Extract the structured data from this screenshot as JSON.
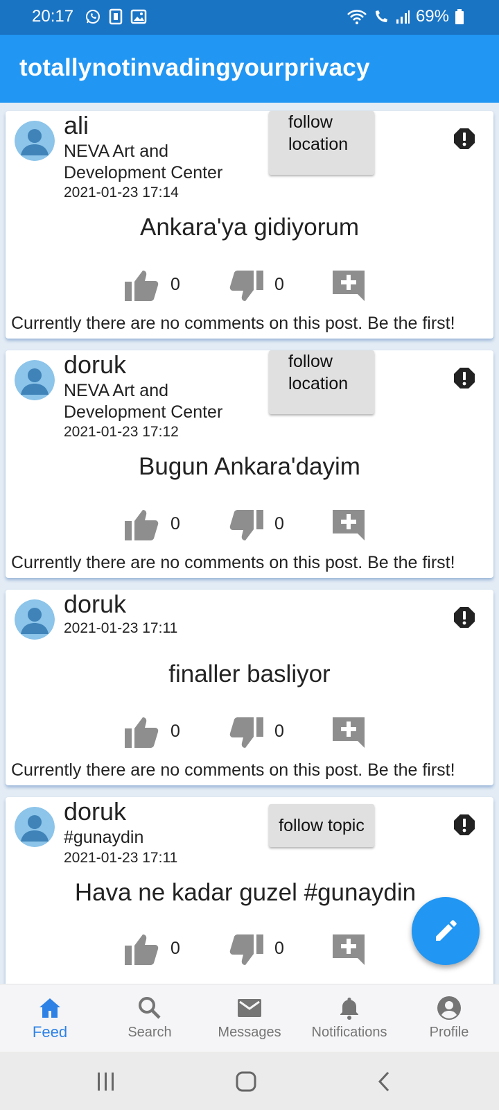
{
  "status_bar": {
    "time": "20:17",
    "battery": "69%"
  },
  "app_bar": {
    "title": "totallynotinvadingyourprivacy"
  },
  "posts": [
    {
      "username": "ali",
      "location": "NEVA Art and Development Center",
      "timestamp": "2021-01-23 17:14",
      "follow_label": "follow location",
      "text": "Ankara'ya gidiyorum",
      "likes": "0",
      "dislikes": "0",
      "comments_text": "Currently there are no comments on this post. Be the first!"
    },
    {
      "username": "doruk",
      "location": "NEVA Art and Development Center",
      "timestamp": "2021-01-23 17:12",
      "follow_label": "follow location",
      "text": "Bugun Ankara'dayim",
      "likes": "0",
      "dislikes": "0",
      "comments_text": "Currently there are no comments on this post. Be the first!"
    },
    {
      "username": "doruk",
      "timestamp": "2021-01-23 17:11",
      "text": "finaller basliyor",
      "likes": "0",
      "dislikes": "0",
      "comments_text": "Currently there are no comments on this post. Be the first!"
    },
    {
      "username": "doruk",
      "topic": "#gunaydin",
      "timestamp": "2021-01-23 17:11",
      "follow_label": "follow topic",
      "text": "Hava ne kadar guzel #gunaydin",
      "likes": "0",
      "dislikes": "0"
    }
  ],
  "bottom_nav": {
    "items": [
      {
        "label": "Feed",
        "icon": "home-icon",
        "active": true
      },
      {
        "label": "Search",
        "icon": "search-icon",
        "active": false
      },
      {
        "label": "Messages",
        "icon": "mail-icon",
        "active": false
      },
      {
        "label": "Notifications",
        "icon": "bell-icon",
        "active": false
      },
      {
        "label": "Profile",
        "icon": "account-icon",
        "active": false
      }
    ]
  },
  "colors": {
    "primary": "#2196f3",
    "status_bar": "#1a74c4",
    "active_nav": "#2e82e6",
    "icon_grey": "#8e8e8e"
  }
}
